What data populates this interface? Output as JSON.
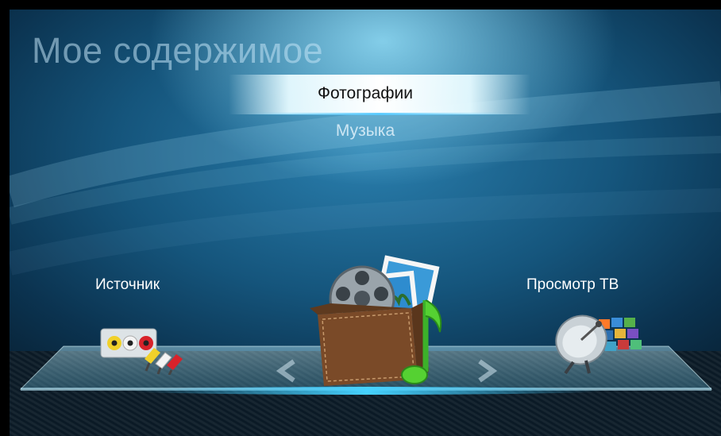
{
  "title": "Мое содержимое",
  "menu": {
    "selected": "Фотографии",
    "items": [
      "Фотографии",
      "Музыка"
    ]
  },
  "carousel": {
    "left_label": "Источник",
    "right_label": "Просмотр ТВ",
    "center_icon": "media-box-icon",
    "left_icon": "av-cables-icon",
    "right_icon": "satellite-dish-icon",
    "nav_left": "chevron-left-icon",
    "nav_right": "chevron-right-icon"
  },
  "colors": {
    "accent": "#4fc8f0",
    "title": "#c3e4f5"
  }
}
